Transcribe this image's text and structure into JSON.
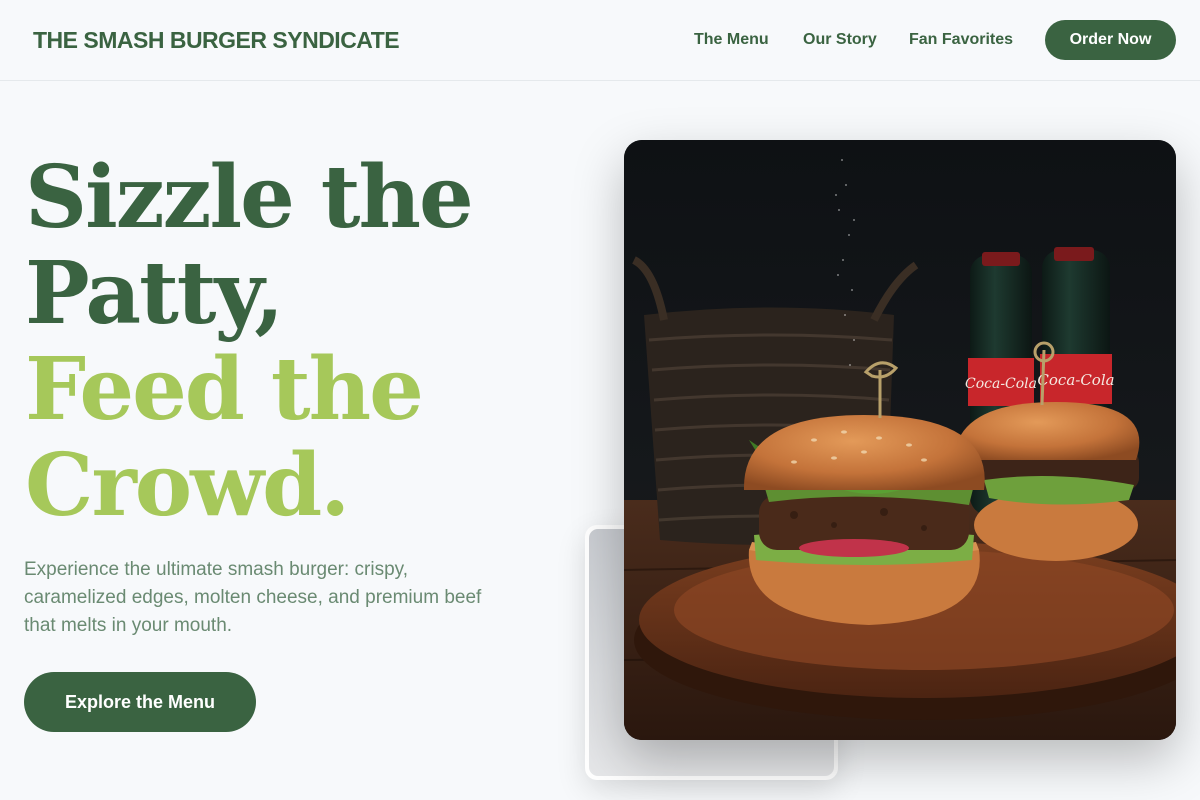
{
  "header": {
    "brand": "THE SMASH BURGER SYNDICATE",
    "nav": [
      {
        "label": "The Menu"
      },
      {
        "label": "Our Story"
      },
      {
        "label": "Fan Favorites"
      }
    ],
    "cta_label": "Order Now"
  },
  "hero": {
    "headline_lines": [
      "Sizzle the",
      "Patty,",
      "Feed the",
      "Crowd."
    ],
    "subtitle": "Experience the ultimate smash burger: crispy, caramelized edges, molten cheese, and premium beef that melts in your mouth.",
    "button_label": "Explore the Menu",
    "bottle_label": "Coca-Cola"
  },
  "colors": {
    "primary": "#3a6341",
    "accent": "#a6c85a",
    "background": "#f7f9fb",
    "subtitle": "#6a8a72"
  }
}
